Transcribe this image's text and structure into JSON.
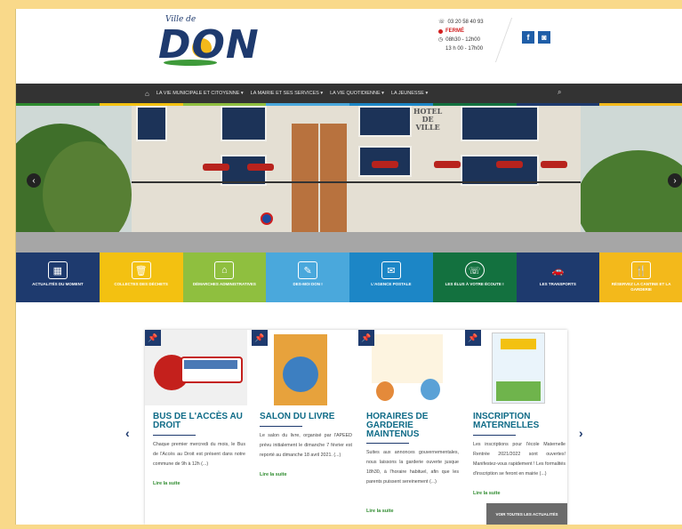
{
  "logo": {
    "small": "Ville de",
    "big": "DON"
  },
  "contact": {
    "phone": "03 20 58 40 93",
    "status": "FERMÉ",
    "hours_1": "08h30 - 12h00",
    "hours_2": "13 h 00 - 17h00"
  },
  "social": {
    "facebook": "f",
    "instagram": "◙"
  },
  "nav": {
    "home_icon": "house-icon",
    "items": [
      "LA VIE MUNICIPALE ET CITOYENNE ▾",
      "LA MAIRIE ET SES SERVICES ▾",
      "LA VIE QUOTIDIENNE ▾",
      "LA JEUNESSE ▾"
    ],
    "search_icon": "search-icon"
  },
  "colors": {
    "green": "#2e8b2e",
    "yellow": "#f3c111",
    "lightgreen": "#8fbf3f",
    "skyblue": "#4aa8dc",
    "blue": "#1c86c6",
    "darkgreen": "#13713f",
    "navy": "#1e3a6e",
    "gold": "#f3b91b"
  },
  "hero": {
    "building_sign": "HOTEL\nDE\nVILLE",
    "prev": "‹",
    "next": "›"
  },
  "tiles": [
    {
      "label": "ACTUALITÉS DU MOMENT",
      "icon": "calendar-icon",
      "glyph": "▦",
      "color": "#1e3a6e"
    },
    {
      "label": "COLLECTES DES DÉCHETS",
      "icon": "trash-icon",
      "glyph": "🗑",
      "color": "#f3c111"
    },
    {
      "label": "DÉMARCHES ADMINISTRATIVES",
      "icon": "building-icon",
      "glyph": "⌂",
      "color": "#8fbf3f"
    },
    {
      "label": "DES-MOI DON !",
      "icon": "document-icon",
      "glyph": "✎",
      "color": "#4aa8dc"
    },
    {
      "label": "L'AGENCE POSTALE",
      "icon": "envelope-icon",
      "glyph": "✉",
      "color": "#1c86c6"
    },
    {
      "label": "LES ÉLUS À VOTRE ÉCOUTE !",
      "icon": "phone-icon",
      "glyph": "☏",
      "color": "#13713f"
    },
    {
      "label": "LES TRANSPORTS",
      "icon": "car-icon",
      "glyph": "🚗",
      "color": "#1e3a6e"
    },
    {
      "label": "RÉSERVEZ LA CANTINE ET LA GARDERIE",
      "icon": "meal-icon",
      "glyph": "🍴",
      "color": "#f3b91b"
    }
  ],
  "news": {
    "cards": [
      {
        "title": "BUS DE L'ACCÈS AU DROIT",
        "body": "Chaque premier mercredi du mois, le Bus de l'Accès au Droit est présent dans notre commune de 9h à 12h (...)",
        "more": "Lire la suite"
      },
      {
        "title": "SALON DU LIVRE",
        "body": "Le salon du livre, organisé par l'APEED prévu initialement le dimanche 7 février est reporté au dimanche 18 avril 2021. (...)",
        "more": "Lire la suite"
      },
      {
        "title": "HORAIRES DE GARDERIE MAINTENUS",
        "body": "Suites aux annonces gouvernementales, nous laissons la garderie ouverte jusque 18h30, à l'horaire habituel, afin que les parents puissent sereinement (...)",
        "more": "Lire la suite"
      },
      {
        "title": "INSCRIPTION MATERNELLES",
        "body": "Les inscriptions pour l'école Maternelle Rentrée 2021/2022 sont ouvertes! Manifestez-vous rapidement ! Les formalités d'inscription se feront en mairie (...)",
        "more": "Lire la suite"
      }
    ],
    "all_news": "VOIR TOUTES LES ACTUALITÉS",
    "prev": "‹",
    "next": "›"
  }
}
